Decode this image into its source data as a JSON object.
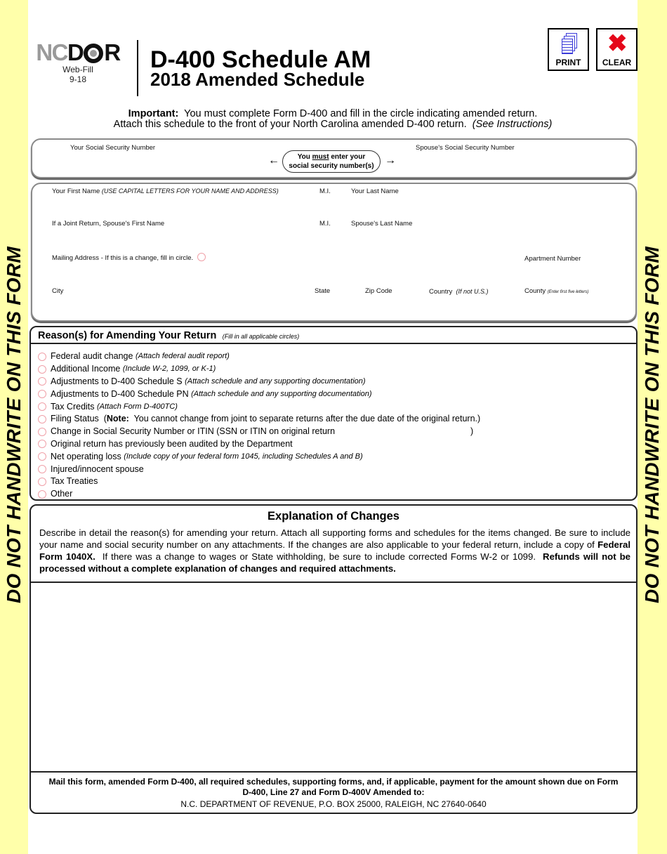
{
  "side_banner": "DO NOT HANDWRITE ON THIS FORM",
  "logo": {
    "nc": "NC",
    "d": "D",
    "r": "R",
    "sub1": "Web-Fill",
    "sub2": "9-18"
  },
  "header": {
    "title": "D-400 Schedule AM",
    "subtitle": "2018 Amended Schedule"
  },
  "toolbar": {
    "print_label": "PRINT",
    "clear_label": "CLEAR",
    "print_icon": "print-icon",
    "clear_icon": "clear-x-icon"
  },
  "important": {
    "label": "Important:",
    "line1": "You must complete Form D-400 and fill in the circle indicating amended return.",
    "line2": "Attach this schedule to the front of your North Carolina amended D-400 return.",
    "line2_italic": "(See Instructions)"
  },
  "ssn": {
    "your_ssn_label": "Your Social Security Number",
    "spouse_ssn_label": "Spouse's Social Security Number",
    "notice_pre": "You ",
    "notice_must": "must",
    "notice_post": " enter your",
    "notice_line2": "social security number(s)",
    "left_arrow": "🡐",
    "right_arrow": "🡒"
  },
  "name_address": {
    "first_name": "Your First Name",
    "first_name_note": "(USE CAPITAL  LETTERS FOR YOUR NAME AND ADDRESS)",
    "mi": "M.I.",
    "last_name": "Your Last Name",
    "spouse_first": "If a Joint Return, Spouse's First Name",
    "spouse_mi": "M.I.",
    "spouse_last": "Spouse's Last Name",
    "mailing": "Mailing Address - If this is a change, fill in circle.",
    "apartment": "Apartment Number",
    "city": "City",
    "state": "State",
    "zip": "Zip Code",
    "country": "Country",
    "country_note": "(If not U.S.)",
    "county": "County",
    "county_note": "(Enter first five letters)"
  },
  "reasons": {
    "title": "Reason(s) for Amending Your Return",
    "note": "(Fill in all applicable circles)",
    "items": [
      {
        "label": "Federal audit change ",
        "note": "(Attach federal audit report)"
      },
      {
        "label": "Additional Income ",
        "note": "(Include W-2, 1099, or K-1)"
      },
      {
        "label": "Adjustments to D-400 Schedule S ",
        "note": "(Attach schedule and any supporting documentation)"
      },
      {
        "label": "Adjustments to D-400 Schedule PN ",
        "note": "(Attach schedule and any supporting documentation)"
      },
      {
        "label": "Tax Credits ",
        "note": "(Attach Form D-400TC)"
      },
      {
        "label": "Filing Status  (",
        "bold": "Note:",
        "rest": "  You cannot change from joint to separate returns after the due date of the original return.)"
      },
      {
        "label": "Change in Social Security Number or ITIN (SSN or ITIN on original return",
        "close": ")"
      },
      {
        "label": "Original return has previously been audited by the Department"
      },
      {
        "label": "Net operating loss ",
        "note": "(Include copy of your federal form 1045, including Schedules A and B)"
      },
      {
        "label": "Injured/innocent spouse"
      },
      {
        "label": "Tax Treaties"
      },
      {
        "label": "Other"
      }
    ]
  },
  "explanation": {
    "title": "Explanation of Changes",
    "p1": "Describe in detail the reason(s) for amending your return.  Attach all supporting forms and schedules for the items changed.  Be sure to include your name and social security number on any attachments.  If the changes are also applicable to your federal return, include a copy of ",
    "p1_bold": "Federal Form 1040X.",
    "p2": "  If there was a change to wages or State withholding, be sure to include corrected Forms W-2 or 1099.  ",
    "p2_bold": "Refunds will not be processed without a complete explanation of changes and required attachments.",
    "value": ""
  },
  "mail": {
    "line1": "Mail this form, amended Form D-400, all required schedules, supporting forms, and, if applicable, payment for the amount shown due on Form D-400, Line 27 and Form D-400V Amended to:",
    "line3": "N.C. DEPARTMENT OF REVENUE, P.O. BOX 25000, RALEIGH, NC 27640-0640"
  }
}
